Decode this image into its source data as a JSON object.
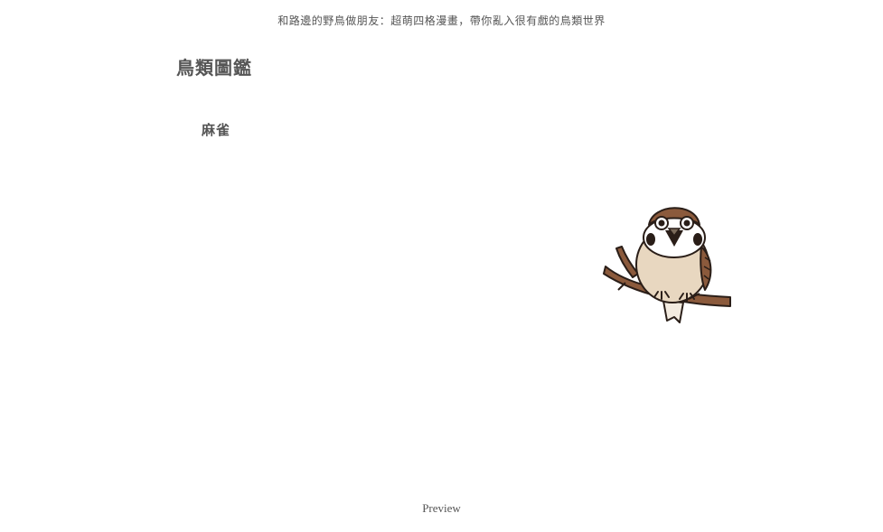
{
  "header": {
    "subtitle": "和路邊的野鳥做朋友：超萌四格漫畫，帶你亂入很有戲的鳥類世界"
  },
  "main": {
    "title": "鳥類圖鑑",
    "bird_name": "麻雀",
    "illustration_icon": "sparrow-on-branch"
  },
  "footer": {
    "preview_label": "Preview"
  }
}
